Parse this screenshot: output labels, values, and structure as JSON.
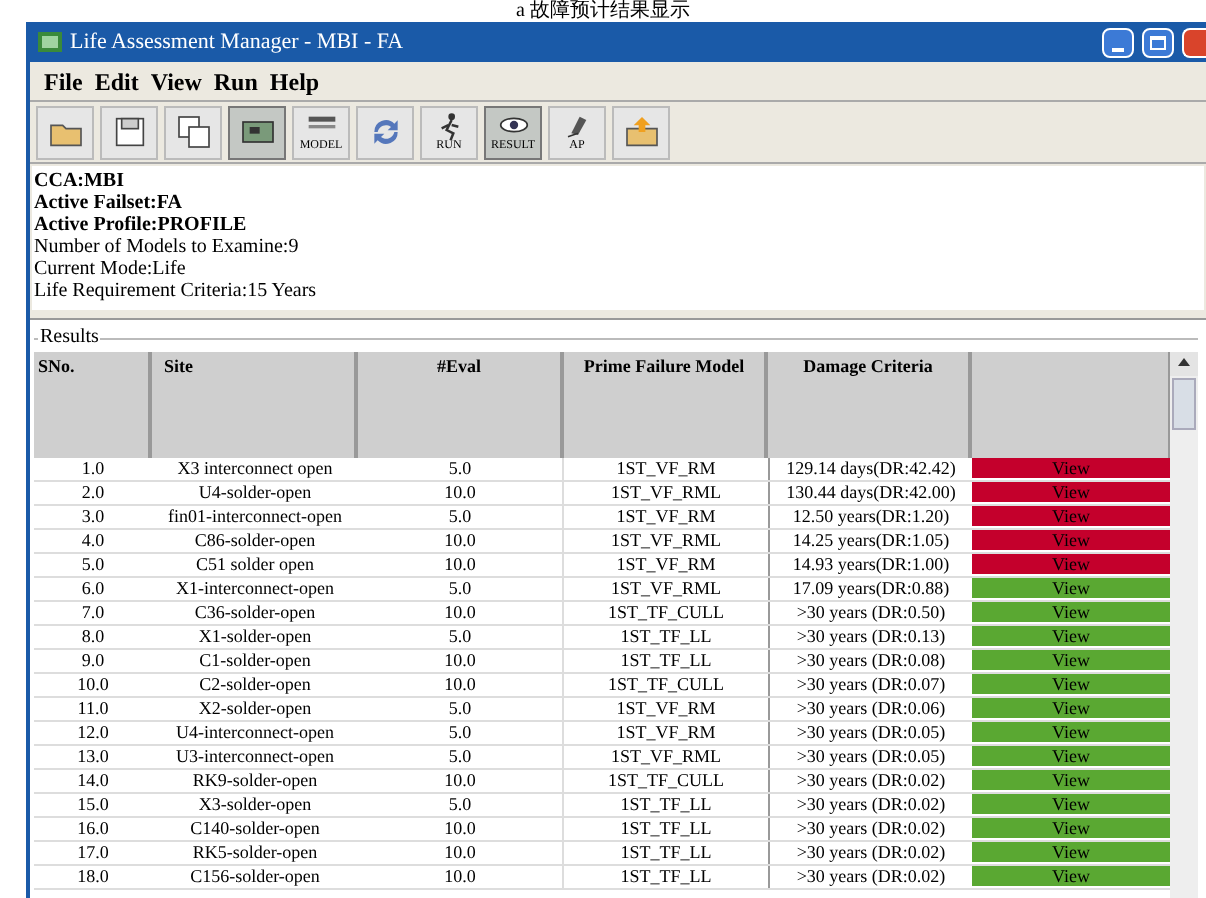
{
  "caption": "a 故障预计结果显示",
  "window": {
    "title": "Life  Assessment Manager - MBI - FA"
  },
  "menu": [
    "File",
    "Edit",
    "View",
    "Run",
    "Help"
  ],
  "toolbar": [
    {
      "kind": "open",
      "pressed": false
    },
    {
      "kind": "save",
      "pressed": false
    },
    {
      "kind": "saveas",
      "pressed": false
    },
    {
      "kind": "board",
      "pressed": true
    },
    {
      "kind": "model",
      "label": "MODEL",
      "pressed": false
    },
    {
      "kind": "refresh",
      "pressed": false
    },
    {
      "kind": "run",
      "label": "RUN",
      "pressed": false
    },
    {
      "kind": "result",
      "label": "RESULT",
      "pressed": true
    },
    {
      "kind": "ap",
      "label": "AP",
      "pressed": false
    },
    {
      "kind": "export",
      "pressed": false
    }
  ],
  "info": [
    "CCA:MBI",
    "Active Failset:FA",
    "Active Profile:PROFILE",
    "Number of Models to Examine:9",
    "Current Mode:Life",
    "Life Requirement Criteria:15 Years"
  ],
  "results": {
    "title": "Results",
    "columns": [
      "SNo.",
      "Site",
      "#Eval",
      "Prime Failure Model",
      "Damage Criteria"
    ],
    "rows": [
      {
        "sno": "1.0",
        "site": "X3 interconnect open",
        "eval": "5.0",
        "model": "1ST_VF_RM",
        "damage": "129.14 days(DR:42.42)",
        "action": "View",
        "color": "#c4002c"
      },
      {
        "sno": "2.0",
        "site": "U4-solder-open",
        "eval": "10.0",
        "model": "1ST_VF_RML",
        "damage": "130.44 days(DR:42.00)",
        "action": "View",
        "color": "#c4002c"
      },
      {
        "sno": "3.0",
        "site": "fin01-interconnect-open",
        "eval": "5.0",
        "model": "1ST_VF_RM",
        "damage": "12.50 years(DR:1.20)",
        "action": "View",
        "color": "#c4002c"
      },
      {
        "sno": "4.0",
        "site": "C86-solder-open",
        "eval": "10.0",
        "model": "1ST_VF_RML",
        "damage": "14.25 years(DR:1.05)",
        "action": "View",
        "color": "#c4002c"
      },
      {
        "sno": "5.0",
        "site": "C51 solder open",
        "eval": "10.0",
        "model": "1ST_VF_RM",
        "damage": "14.93 years(DR:1.00)",
        "action": "View",
        "color": "#c4002c"
      },
      {
        "sno": "6.0",
        "site": "X1-interconnect-open",
        "eval": "5.0",
        "model": "1ST_VF_RML",
        "damage": "17.09 years(DR:0.88)",
        "action": "View",
        "color": "#5aa832"
      },
      {
        "sno": "7.0",
        "site": "C36-solder-open",
        "eval": "10.0",
        "model": "1ST_TF_CULL",
        "damage": ">30 years (DR:0.50)",
        "action": "View",
        "color": "#5aa832"
      },
      {
        "sno": "8.0",
        "site": "X1-solder-open",
        "eval": "5.0",
        "model": "1ST_TF_LL",
        "damage": ">30 years (DR:0.13)",
        "action": "View",
        "color": "#5aa832"
      },
      {
        "sno": "9.0",
        "site": "C1-solder-open",
        "eval": "10.0",
        "model": "1ST_TF_LL",
        "damage": ">30 years (DR:0.08)",
        "action": "View",
        "color": "#5aa832"
      },
      {
        "sno": "10.0",
        "site": "C2-solder-open",
        "eval": "10.0",
        "model": "1ST_TF_CULL",
        "damage": ">30 years (DR:0.07)",
        "action": "View",
        "color": "#5aa832"
      },
      {
        "sno": "11.0",
        "site": "X2-solder-open",
        "eval": "5.0",
        "model": "1ST_VF_RM",
        "damage": ">30 years (DR:0.06)",
        "action": "View",
        "color": "#5aa832"
      },
      {
        "sno": "12.0",
        "site": "U4-interconnect-open",
        "eval": "5.0",
        "model": "1ST_VF_RM",
        "damage": ">30 years (DR:0.05)",
        "action": "View",
        "color": "#5aa832"
      },
      {
        "sno": "13.0",
        "site": "U3-interconnect-open",
        "eval": "5.0",
        "model": "1ST_VF_RML",
        "damage": ">30 years (DR:0.05)",
        "action": "View",
        "color": "#5aa832"
      },
      {
        "sno": "14.0",
        "site": "RK9-solder-open",
        "eval": "10.0",
        "model": "1ST_TF_CULL",
        "damage": ">30 years (DR:0.02)",
        "action": "View",
        "color": "#5aa832"
      },
      {
        "sno": "15.0",
        "site": "X3-solder-open",
        "eval": "5.0",
        "model": "1ST_TF_LL",
        "damage": ">30 years (DR:0.02)",
        "action": "View",
        "color": "#5aa832"
      },
      {
        "sno": "16.0",
        "site": "C140-solder-open",
        "eval": "10.0",
        "model": "1ST_TF_LL",
        "damage": ">30 years (DR:0.02)",
        "action": "View",
        "color": "#5aa832"
      },
      {
        "sno": "17.0",
        "site": "RK5-solder-open",
        "eval": "10.0",
        "model": "1ST_TF_LL",
        "damage": ">30 years (DR:0.02)",
        "action": "View",
        "color": "#5aa832"
      },
      {
        "sno": "18.0",
        "site": "C156-solder-open",
        "eval": "10.0",
        "model": "1ST_TF_LL",
        "damage": ">30 years (DR:0.02)",
        "action": "View",
        "color": "#5aa832"
      }
    ]
  }
}
